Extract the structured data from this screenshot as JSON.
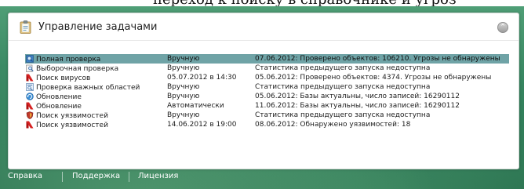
{
  "top_fragment": "переход к поиску в справочнике и угроз",
  "panel": {
    "title": "Управление задачами"
  },
  "tasks": [
    {
      "icon": "full-scan-icon",
      "name": "Полная проверка",
      "run_mode": "Вручную",
      "status": "07.06.2012: Проверено объектов: 106210. Угрозы не обнаружены",
      "selected": true
    },
    {
      "icon": "custom-scan-icon",
      "name": "Выборочная проверка",
      "run_mode": "Вручную",
      "status": "Статистика предыдущего запуска недоступна"
    },
    {
      "icon": "virus-scan-icon",
      "name": "Поиск вирусов",
      "run_mode": "05.07.2012 в 14:30",
      "status": "05.06.2012: Проверено объектов: 4374. Угрозы не обнаружены"
    },
    {
      "icon": "critical-areas-icon",
      "name": "Проверка важных областей",
      "run_mode": "Вручную",
      "status": "Статистика предыдущего запуска недоступна"
    },
    {
      "icon": "update-icon",
      "name": "Обновление",
      "run_mode": "Вручную",
      "status": "05.06.2012: Базы актуальны, число записей: 16290112"
    },
    {
      "icon": "update-auto-icon",
      "name": "Обновление",
      "run_mode": "Автоматически",
      "status": "11.06.2012: Базы актуальны, число записей: 16290112"
    },
    {
      "icon": "vulnerability-scan-icon",
      "name": "Поиск уязвимостей",
      "run_mode": "Вручную",
      "status": "Статистика предыдущего запуска недоступна"
    },
    {
      "icon": "vulnerability-scan-scheduled-icon",
      "name": "Поиск уязвимостей",
      "run_mode": "14.06.2012 в 19:00",
      "status": "08.06.2012: Обнаружено уязвимостей: 18"
    }
  ],
  "footer": {
    "help": "Справка",
    "support": "Поддержка",
    "license": "Лицензия"
  },
  "colors": {
    "selection": "#6fa3a6",
    "background_green": "#2f7d59",
    "panel": "#ffffff"
  }
}
